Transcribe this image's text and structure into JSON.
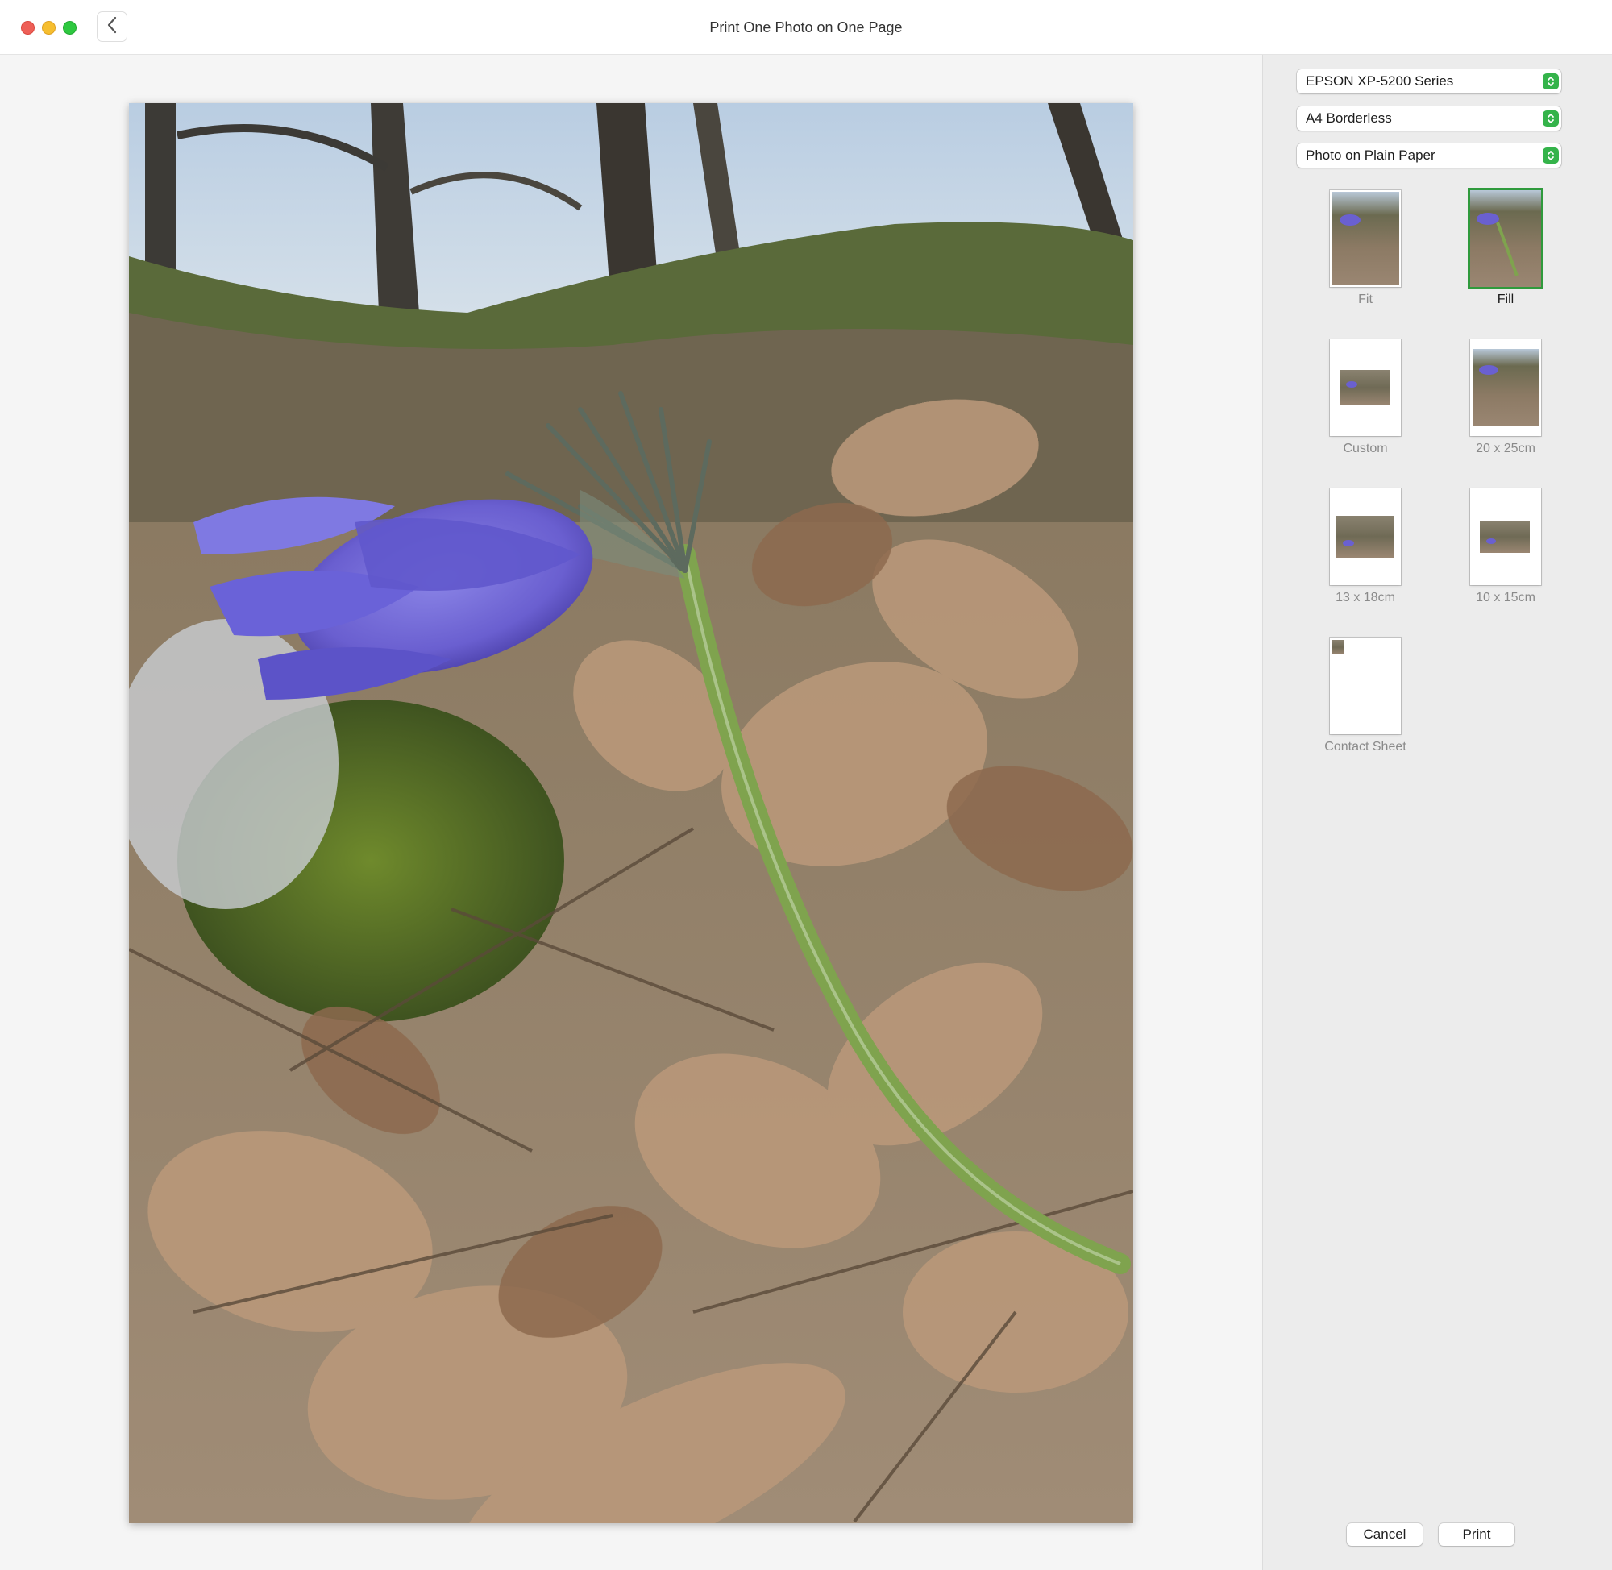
{
  "window": {
    "title": "Print One Photo on One Page"
  },
  "sidebar": {
    "printer": "EPSON XP-5200 Series",
    "paper_size": "A4 Borderless",
    "paper_type": "Photo on Plain Paper",
    "layouts": [
      {
        "label": "Fit",
        "selected": false
      },
      {
        "label": "Fill",
        "selected": true
      },
      {
        "label": "Custom",
        "selected": false
      },
      {
        "label": "20 x 25cm",
        "selected": false
      },
      {
        "label": "13 x 18cm",
        "selected": false
      },
      {
        "label": "10 x 15cm",
        "selected": false
      },
      {
        "label": "Contact Sheet",
        "selected": false
      }
    ]
  },
  "footer": {
    "cancel_label": "Cancel",
    "print_label": "Print"
  },
  "colors": {
    "accent": "#34b34a",
    "selection": "#2f9a3c",
    "close": "#ee5f57",
    "minimize": "#f6be2f",
    "maximize": "#2ec840"
  },
  "icons": {
    "back": "chevron-left-icon",
    "stepper": "up-down-chevron-icon"
  }
}
